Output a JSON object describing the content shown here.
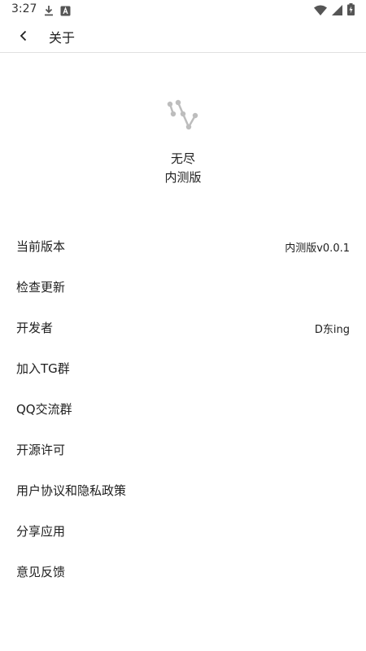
{
  "status_bar": {
    "time": "3:27",
    "icons": [
      "download-icon",
      "text-icon",
      "wifi-icon",
      "signal-icon",
      "battery-icon"
    ]
  },
  "toolbar": {
    "title": "关于",
    "back_icon": "chevron-left-icon"
  },
  "app": {
    "logo_icon": "app-logo-icon",
    "name": "无尽",
    "edition": "内测版"
  },
  "items": [
    {
      "label": "当前版本",
      "value": "内测版v0.0.1"
    },
    {
      "label": "检查更新",
      "value": ""
    },
    {
      "label": "开发者",
      "value": "D东ing"
    },
    {
      "label": "加入TG群",
      "value": ""
    },
    {
      "label": "QQ交流群",
      "value": ""
    },
    {
      "label": "开源许可",
      "value": ""
    },
    {
      "label": "用户协议和隐私政策",
      "value": ""
    },
    {
      "label": "分享应用",
      "value": ""
    },
    {
      "label": "意见反馈",
      "value": ""
    }
  ],
  "colors": {
    "text": "#202020",
    "divider": "#e0e0e0",
    "logo": "#bdbdbd"
  }
}
